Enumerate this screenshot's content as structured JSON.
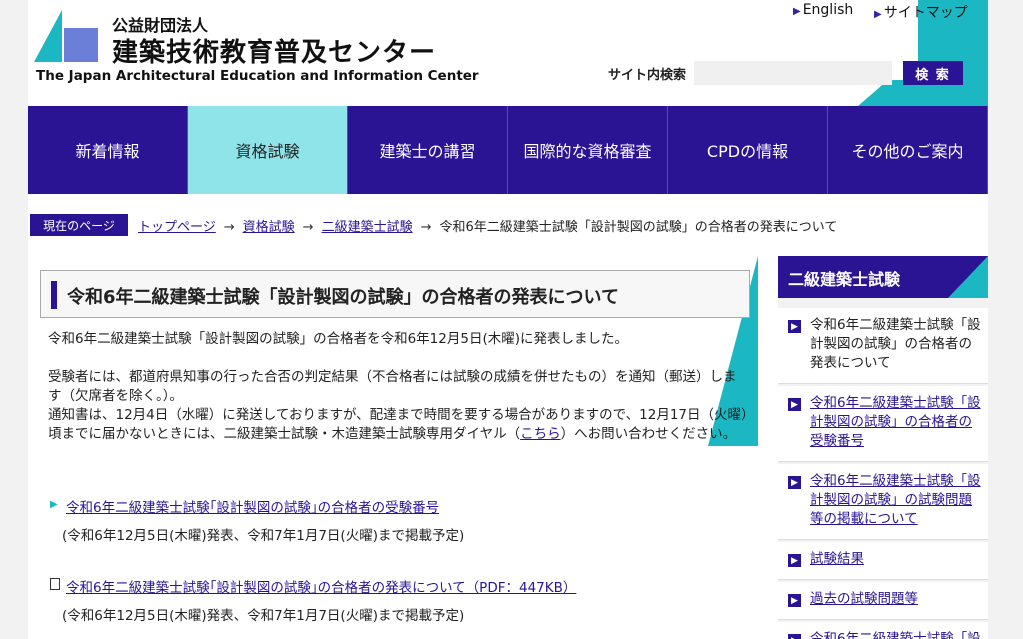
{
  "header": {
    "org_sub": "公益財団法人",
    "org_name": "建築技術教育普及センター",
    "org_en": "The Japan Architectural Education and Information Center",
    "links": [
      {
        "label": "English"
      },
      {
        "label": "サイトマップ"
      }
    ],
    "search": {
      "label": "サイト内検索",
      "value": "",
      "button": "検 索"
    }
  },
  "nav": {
    "items": [
      {
        "label": "新着情報"
      },
      {
        "label": "資格試験"
      },
      {
        "label": "建築士の講習"
      },
      {
        "label": "国際的な資格審査"
      },
      {
        "label": "CPDの情報"
      },
      {
        "label": "その他のご案内"
      }
    ]
  },
  "breadcrumb": {
    "label": "現在のページ",
    "items": [
      "トップページ",
      "資格試験",
      "二級建築士試験"
    ],
    "current": "令和6年二級建築士試験「設計製図の試験」の合格者の発表について"
  },
  "main": {
    "title": "令和6年二級建築士試験「設計製図の試験」の合格者の発表について",
    "para1": "令和6年二級建築士試験「設計製図の試験」の合格者を令和6年12月5日(木曜)に発表しました。",
    "para2": "受験者には、都道府県知事の行った合否の判定結果（不合格者には試験の成績を併せたもの）を通知（郵送）します（欠席者を除く。）。",
    "para3_pre": "通知書は、12月4日（水曜）に発送しておりますが、配達まで時間を要する場合がありますので、12月17日（火曜）頃までに届かないときには、二級建築士試験・木造建築士試験専用ダイヤル（",
    "para3_link": "こちら",
    "para3_post": "）へお問い合わせください。",
    "downloads": [
      {
        "label": "令和6年二級建築士試験｢設計製図の試験｣の合格者の受験番号",
        "note": "(令和6年12月5日(木曜)発表、令和7年1月7日(火曜)まで掲載予定)"
      },
      {
        "label": "令和6年二級建築士試験｢設計製図の試験｣の合格者の発表について（PDF：447KB）",
        "note": "(令和6年12月5日(木曜)発表、令和7年1月7日(火曜)まで掲載予定)"
      }
    ]
  },
  "sidebar": {
    "heading": "二級建築士試験",
    "items": [
      {
        "label": "令和6年二級建築士試験「設計製図の試験」の合格者の発表について"
      },
      {
        "label": "令和6年二級建築士試験「設計製図の試験」の合格者の受験番号"
      },
      {
        "label": "令和6年二級建築士試験「設計製図の試験」の試験問題等の掲載について"
      },
      {
        "label": "試験結果"
      },
      {
        "label": "過去の試験問題等"
      },
      {
        "label": "令和6年二級建築士試験「設"
      }
    ]
  },
  "colors": {
    "brand": "#2a1493",
    "accent": "#1bb8c3",
    "nav_active": "#8fe4ea"
  }
}
